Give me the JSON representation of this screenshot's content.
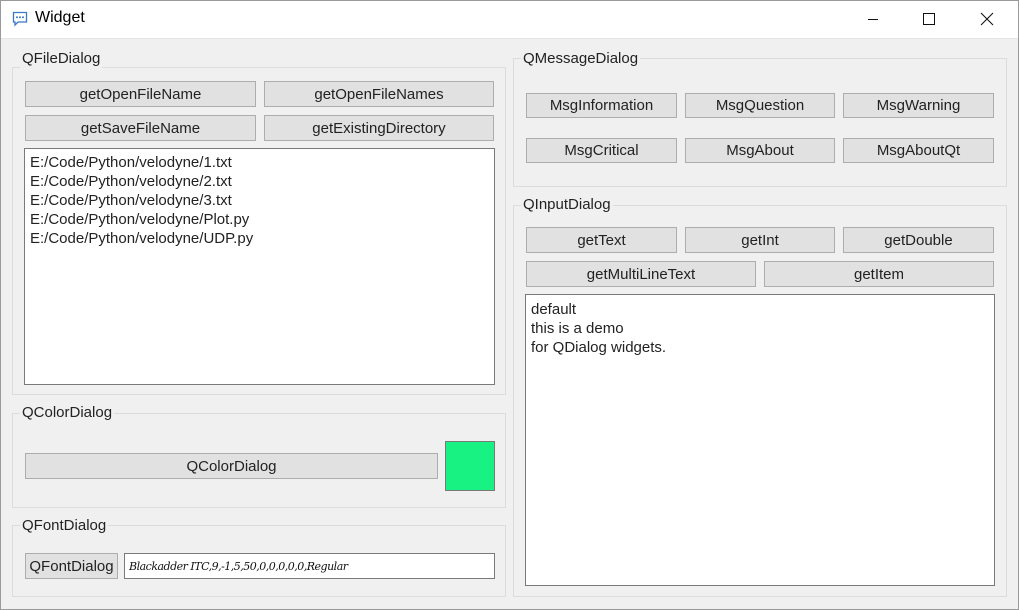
{
  "window": {
    "title": "Widget"
  },
  "file_dialog": {
    "title": "QFileDialog",
    "buttons": [
      "getOpenFileName",
      "getOpenFileNames",
      "getSaveFileName",
      "getExistingDirectory"
    ],
    "files": [
      "E:/Code/Python/velodyne/1.txt",
      "E:/Code/Python/velodyne/2.txt",
      "E:/Code/Python/velodyne/3.txt",
      "E:/Code/Python/velodyne/Plot.py",
      "E:/Code/Python/velodyne/UDP.py"
    ]
  },
  "color_dialog": {
    "title": "QColorDialog",
    "button": "QColorDialog",
    "color": "#17f282"
  },
  "font_dialog": {
    "title": "QFontDialog",
    "button": "QFontDialog",
    "value": "Blackadder ITC,9,-1,5,50,0,0,0,0,0,Regular"
  },
  "message_dialog": {
    "title": "QMessageDialog",
    "buttons": [
      "MsgInformation",
      "MsgQuestion",
      "MsgWarning",
      "MsgCritical",
      "MsgAbout",
      "MsgAboutQt"
    ]
  },
  "input_dialog": {
    "title": "QInputDialog",
    "buttons": [
      "getText",
      "getInt",
      "getDouble",
      "getMultiLineText",
      "getItem"
    ],
    "lines": [
      "default",
      "this is a demo",
      "for QDialog widgets."
    ]
  }
}
